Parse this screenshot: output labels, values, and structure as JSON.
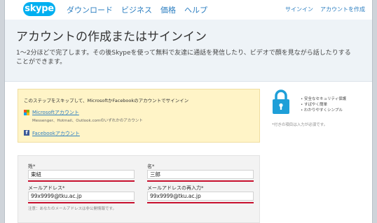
{
  "header": {
    "logo_text": "skype",
    "nav": [
      "ダウンロード",
      "ビジネス",
      "価格",
      "ヘルプ"
    ],
    "signin": "サインイン",
    "create_account": "アカウントを作成"
  },
  "hero": {
    "title": "アカウントの作成またはサインイン",
    "description": "1～2分ほどで完了します。その後Skypeを使って無料で友達に通話を発信したり、ビデオで顔を見ながら話したりすることができます。"
  },
  "skip": {
    "title": "このステップをスキップして、MicrosoftかFacebookのアカウントでサインイン",
    "microsoft_label": "Microsoftアカウント",
    "microsoft_sub": "Messenger、Hotmail、Outlook.comのいずれかのアカウント",
    "facebook_label": "Facebookアカウント"
  },
  "benefits": [
    "安全なセキュリティ保護",
    "すばやく簡単",
    "わかりやすくシンプル"
  ],
  "required_note": "*付きの項目は入力が必須です。",
  "form": {
    "last_name_label": "姓*",
    "last_name_value": "東紐",
    "first_name_label": "名*",
    "first_name_value": "三郎",
    "email_label": "メールアドレス*",
    "email_value": "99x9999@tku.ac.jp",
    "email_confirm_label": "メールアドレスの再入力*",
    "email_confirm_value": "99x9999@tku.ac.jp",
    "email_hint": "注意：あなたのメールアドレスは非公開情報です。"
  },
  "colors": {
    "brand": "#00aff0",
    "link": "#2d7fc1",
    "hero_bg": "#eef3f7",
    "skip_bg": "#fff4c7",
    "lock": "#1e9fd8",
    "underline": "#c8102e",
    "facebook": "#3b5998"
  },
  "icons": {
    "lock": "lock-icon",
    "microsoft": "microsoft-logo-icon",
    "facebook": "facebook-icon"
  }
}
